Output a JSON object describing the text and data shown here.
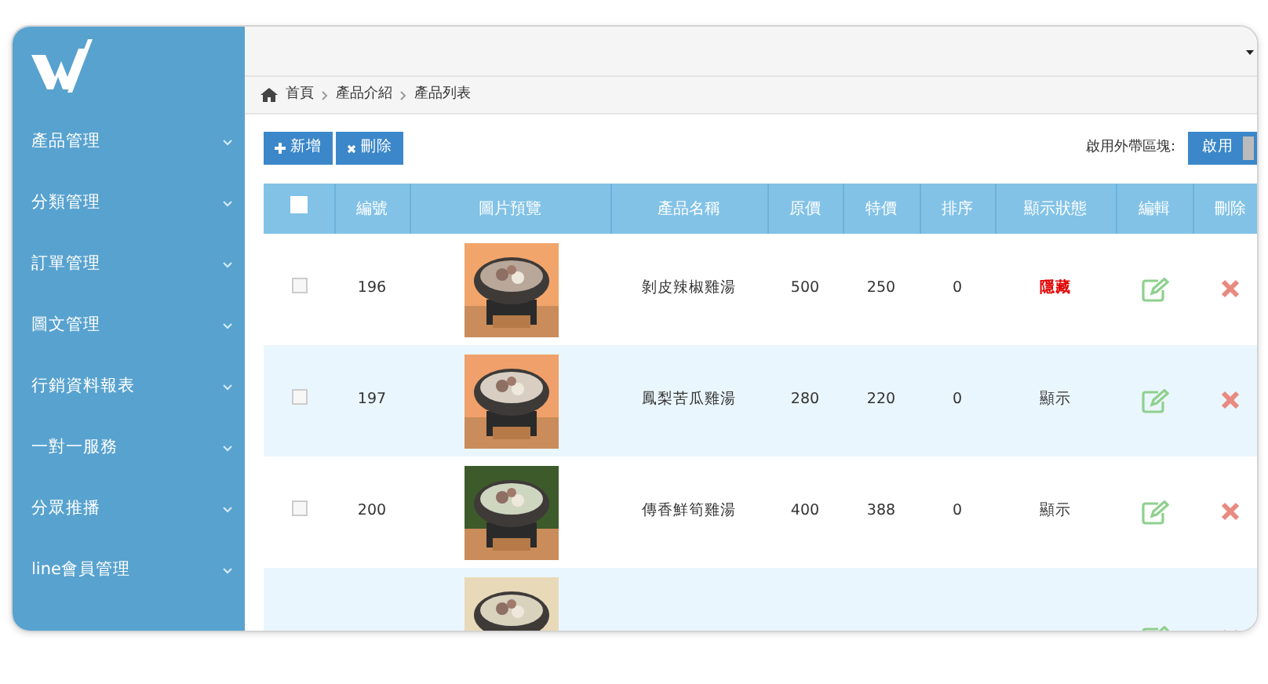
{
  "sidebar": {
    "items": [
      {
        "label": "產品管理"
      },
      {
        "label": "分類管理"
      },
      {
        "label": "訂單管理"
      },
      {
        "label": "圖文管理"
      },
      {
        "label": "行銷資料報表"
      },
      {
        "label": "一對一服務"
      },
      {
        "label": "分眾推播"
      },
      {
        "label": "line會員管理"
      }
    ]
  },
  "breadcrumb": [
    {
      "label": "首頁"
    },
    {
      "label": "產品介紹"
    },
    {
      "label": "產品列表"
    }
  ],
  "toolbar": {
    "buttons": [
      {
        "label": "新增",
        "kind": "add"
      },
      {
        "label": "刪除",
        "kind": "delete"
      }
    ],
    "takeout": {
      "label": "啟用外帶區塊:",
      "toggle": {
        "label": "啟用",
        "on": true
      }
    }
  },
  "table": {
    "header_checked": false,
    "columns": [
      "編號",
      "圖片預覽",
      "產品名稱",
      "原價",
      "特價",
      "排序",
      "顯示狀態",
      "編輯",
      "刪除"
    ],
    "rows": [
      {
        "checked": false,
        "id": "196",
        "name": "剝皮辣椒雞湯",
        "price": "500",
        "sale": "250",
        "order": "0",
        "status": "隱藏",
        "hidden": true
      },
      {
        "checked": false,
        "id": "197",
        "name": "鳳梨苦瓜雞湯",
        "price": "280",
        "sale": "220",
        "order": "0",
        "status": "顯示",
        "hidden": false
      },
      {
        "checked": false,
        "id": "200",
        "name": "傳香鮮筍雞湯",
        "price": "400",
        "sale": "388",
        "order": "0",
        "status": "顯示",
        "hidden": false
      },
      {
        "partial": true
      }
    ]
  }
}
